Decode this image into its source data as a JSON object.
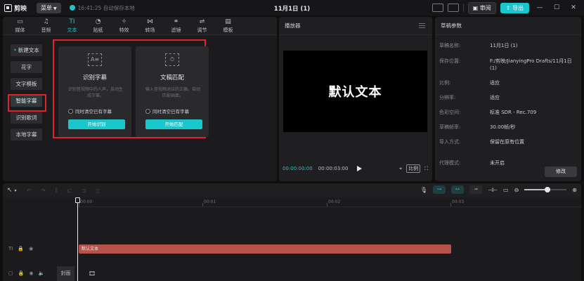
{
  "titlebar": {
    "logo_text": "剪映",
    "menu_label": "菜单",
    "autosave_text": "16:41:25 自动保存本地",
    "project_title": "11月1日 (1)",
    "review_label": "审阅",
    "export_label": "导出"
  },
  "media": {
    "tabs": [
      {
        "label": "媒体",
        "icon": "media-icon",
        "glyph": "▭"
      },
      {
        "label": "音频",
        "icon": "audio-icon",
        "glyph": "♫"
      },
      {
        "label": "文本",
        "icon": "text-icon",
        "glyph": "TI"
      },
      {
        "label": "贴纸",
        "icon": "sticker-icon",
        "glyph": "◔"
      },
      {
        "label": "特效",
        "icon": "effects-icon",
        "glyph": "✧"
      },
      {
        "label": "转场",
        "icon": "transition-icon",
        "glyph": "⋈"
      },
      {
        "label": "滤镜",
        "icon": "filter-icon",
        "glyph": "⚭"
      },
      {
        "label": "调节",
        "icon": "adjust-icon",
        "glyph": "⇌"
      },
      {
        "label": "模板",
        "icon": "template-icon",
        "glyph": "▤"
      }
    ],
    "active_tab": "文本",
    "side_items": [
      "新建文本",
      "花字",
      "文字模板",
      "智能字幕",
      "识别歌词",
      "本地字幕"
    ],
    "cards": [
      {
        "title": "识别字幕",
        "icon_glyph": "A≡",
        "desc": "识别音视频中的人声，自动生成字幕。",
        "checkbox_label": "同时清空已有字幕",
        "button_label": "开始识别"
      },
      {
        "title": "文稿匹配",
        "icon_glyph": "⏱",
        "desc": "输入音视频对应的文稿，自动匹配画面。",
        "checkbox_label": "同时清空已有字幕",
        "button_label": "开始匹配"
      }
    ]
  },
  "player": {
    "header": "播放器",
    "video_text": "默认文本",
    "time_current": "00:00:00:00",
    "time_total": "00:00:03:00",
    "ratio_label": "比例"
  },
  "props": {
    "header": "草稿参数",
    "rows": [
      {
        "label": "草稿名称:",
        "value": "11月1日 (1)"
      },
      {
        "label": "保存位置:",
        "value": "F:/剪映/JianyingPro Drafts/11月1日 (1)"
      },
      {
        "label": "比例:",
        "value": "适应"
      },
      {
        "label": "分辨率:",
        "value": "适应"
      },
      {
        "label": "色彩空间:",
        "value": "标准 SDR - Rec.709"
      },
      {
        "label": "草稿帧率:",
        "value": "30.00帧/秒"
      },
      {
        "label": "导入方式:",
        "value": "保留在原有位置"
      },
      {
        "label": "代理模式:",
        "value": "未开启"
      }
    ],
    "edit_label": "修改"
  },
  "timeline": {
    "zoom_level": 0.55,
    "ruler": [
      "00:00",
      "00:01",
      "00:02",
      "00:03"
    ],
    "clip_label": "默认文本",
    "cover_label": "封面"
  },
  "colors": {
    "accent": "#18c6cc",
    "highlight_border": "#e0222a",
    "clip": "#b4524b"
  }
}
